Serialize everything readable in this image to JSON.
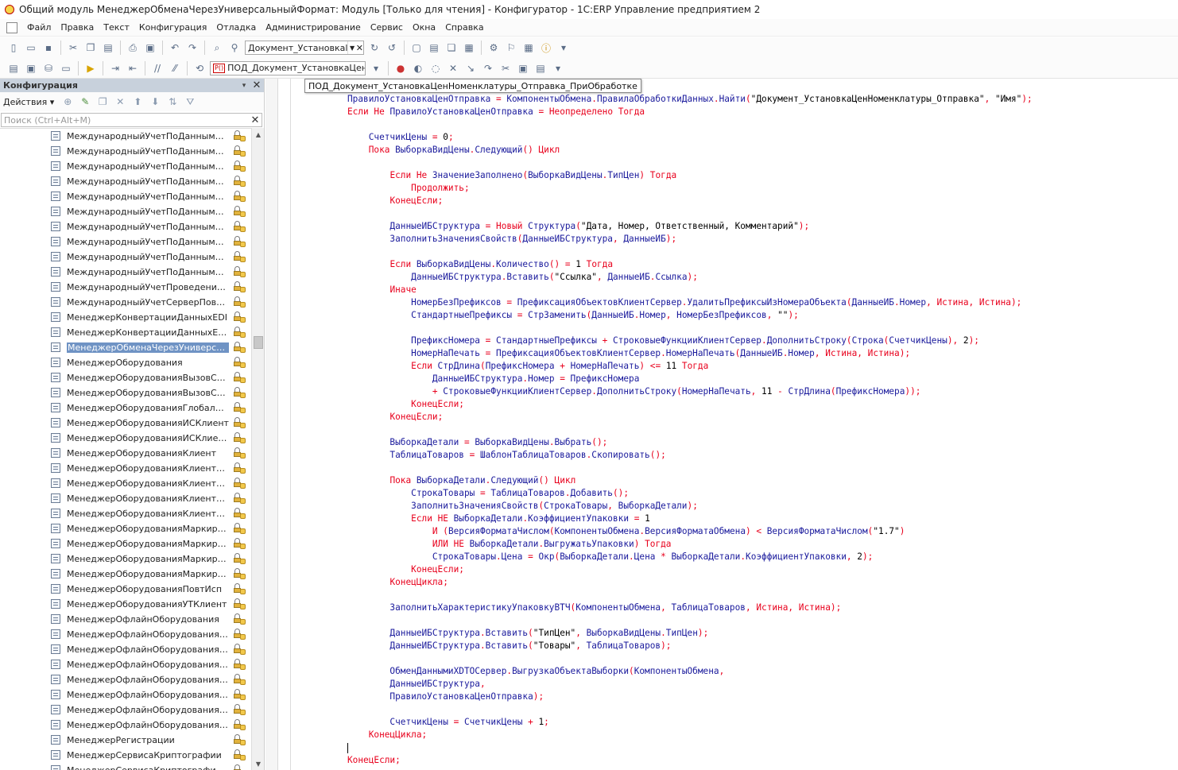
{
  "window": {
    "title": "Общий модуль МенеджерОбменаЧерезУниверсальныйФормат: Модуль [Только для чтения] - Конфигуратор - 1С:ERP Управление предприятием 2"
  },
  "menu": {
    "items": [
      "Файл",
      "Правка",
      "Текст",
      "Конфигурация",
      "Отладка",
      "Администрирование",
      "Сервис",
      "Окна",
      "Справка"
    ]
  },
  "toolbar1": {
    "search_combo_value": "Документ_Установкаl"
  },
  "toolbar2": {
    "procedure_combo_value": "ПОД_Документ_УстановкаЦен"
  },
  "panel": {
    "title": "Конфигурация",
    "actions_label": "Действия",
    "search_placeholder": "Поиск (Ctrl+Alt+M)",
    "items": [
      "МеждународныйУчетПоДаннымДоку...",
      "МеждународныйУчетПоДаннымОпера...",
      "МеждународныйУчетПоДаннымОпера...",
      "МеждународныйУчетПоДаннымРеглУ...",
      "МеждународныйУчетПоДаннымРеглУ...",
      "МеждународныйУчетПоДаннымФина...",
      "МеждународныйУчетПоДаннымФина...",
      "МеждународныйУчетПоДаннымФина...",
      "МеждународныйУчетПоДаннымФина...",
      "МеждународныйУчетПоДаннымФина...",
      "МеждународныйУчетПроведениеСерв...",
      "МеждународныйУчетСерверПовтИсп",
      "МенеджерКонвертацииДанныхEDI",
      "МенеджерКонвертацииДанныхEDIПов...",
      "МенеджерОбменаЧерезУниверсальн...",
      "МенеджерОборудования",
      "МенеджерОборудованияВызовСервера",
      "МенеджерОборудованияВызовСервер...",
      "МенеджерОборудованияГлобальный",
      "МенеджерОборудованияИСКлиент",
      "МенеджерОборудованияИСКлиентПов...",
      "МенеджерОборудованияКлиент",
      "МенеджерОборудованияКлиентПерео...",
      "МенеджерОборудованияКлиентПовтИ...",
      "МенеджерОборудованияКлиентСервер",
      "МенеджерОборудованияКлиентСерве...",
      "МенеджерОборудованияМаркировка",
      "МенеджерОборудованияМаркировкаВ...",
      "МенеджерОборудованияМаркировкаК...",
      "МенеджерОборудованияМаркировкаК...",
      "МенеджерОборудованияПовтИсп",
      "МенеджерОборудованияУТКлиент",
      "МенеджерОфлайнОборудования",
      "МенеджерОфлайнОборудованияWebC...",
      "МенеджерОфлайнОборудованияВызо...",
      "МенеджерОфлайнОборудованияВызо...",
      "МенеджерОфлайнОборудованияКлиент",
      "МенеджерОфлайнОборудованияКлиен...",
      "МенеджерОфлайнОборудованияКлиен...",
      "МенеджерОфлайнОборудованияПере...",
      "МенеджерРегистрации",
      "МенеджерСервисаКриптографии",
      "МенеджерСервисаКриптографииКлие..."
    ],
    "selected_index": 14
  },
  "editor": {
    "tooltip": "ПОД_Документ_УстановкаЦенНоменклатуры_Отправка_ПриОбработке",
    "lines": [
      "ПравилоУстановкаЦенОтправка = КомпонентыОбмена.ПравилаОбработкиДанных.Найти(\"Документ_УстановкаЦенНоменклатуры_Отправка\", \"Имя\");",
      "Если Не ПравилоУстановкаЦенОтправка = Неопределено Тогда",
      "",
      "    СчетчикЦены = 0;",
      "    Пока ВыборкаВидЦены.Следующий() Цикл",
      "",
      "        Если Не ЗначениеЗаполнено(ВыборкаВидЦены.ТипЦен) Тогда",
      "            Продолжить;",
      "        КонецЕсли;",
      "",
      "        ДанныеИБСтруктура = Новый Структура(\"Дата, Номер, Ответственный, Комментарий\");",
      "        ЗаполнитьЗначенияСвойств(ДанныеИБСтруктура, ДанныеИБ);",
      "",
      "        Если ВыборкаВидЦены.Количество() = 1 Тогда",
      "            ДанныеИБСтруктура.Вставить(\"Ссылка\", ДанныеИБ.Ссылка);",
      "        Иначе",
      "            НомерБезПрефиксов = ПрефиксацияОбъектовКлиентСервер.УдалитьПрефиксыИзНомераОбъекта(ДанныеИБ.Номер, Истина, Истина);",
      "            СтандартныеПрефиксы = СтрЗаменить(ДанныеИБ.Номер, НомерБезПрефиксов, \"\");",
      "",
      "            ПрефиксНомера = СтандартныеПрефиксы + СтроковыеФункцииКлиентСервер.ДополнитьСтроку(Строка(СчетчикЦены), 2);",
      "            НомерНаПечать = ПрефиксацияОбъектовКлиентСервер.НомерНаПечать(ДанныеИБ.Номер, Истина, Истина);",
      "            Если СтрДлина(ПрефиксНомера + НомерНаПечать) <= 11 Тогда",
      "                ДанныеИБСтруктура.Номер = ПрефиксНомера",
      "                + СтроковыеФункцииКлиентСервер.ДополнитьСтроку(НомерНаПечать, 11 - СтрДлина(ПрефиксНомера));",
      "            КонецЕсли;",
      "        КонецЕсли;",
      "",
      "        ВыборкаДетали = ВыборкаВидЦены.Выбрать();",
      "        ТаблицаТоваров = ШаблонТаблицаТоваров.Скопировать();",
      "",
      "        Пока ВыборкаДетали.Следующий() Цикл",
      "            СтрокаТовары = ТаблицаТоваров.Добавить();",
      "            ЗаполнитьЗначенияСвойств(СтрокаТовары, ВыборкаДетали);",
      "            Если НЕ ВыборкаДетали.КоэффициентУпаковки = 1",
      "                И (ВерсияФорматаЧислом(КомпонентыОбмена.ВерсияФорматаОбмена) < ВерсияФорматаЧислом(\"1.7\")",
      "                ИЛИ НЕ ВыборкаДетали.ВыгружатьУпаковки) Тогда",
      "                СтрокаТовары.Цена = Окр(ВыборкаДетали.Цена * ВыборкаДетали.КоэффициентУпаковки, 2);",
      "            КонецЕсли;",
      "        КонецЦикла;",
      "",
      "        ЗаполнитьХарактеристикуУпаковкуВТЧ(КомпонентыОбмена, ТаблицаТоваров, Истина, Истина);",
      "",
      "        ДанныеИБСтруктура.Вставить(\"ТипЦен\", ВыборкаВидЦены.ТипЦен);",
      "        ДанныеИБСтруктура.Вставить(\"Товары\", ТаблицаТоваров);",
      "",
      "        ОбменДаннымиXDTOСервер.ВыгрузкаОбъектаВыборки(КомпонентыОбмена,",
      "        ДанныеИБСтруктура,",
      "        ПравилоУстановкаЦенОтправка);",
      "",
      "        СчетчикЦены = СчетчикЦены + 1;",
      "    КонецЦикла;",
      "",
      "КонецЕсли;"
    ],
    "caret_line": 51
  },
  "colors": {
    "keyword": "#e8001c",
    "identifier": "#1a1a9c",
    "string": "#000000",
    "selection": "#6f93c4",
    "panel_header": "#c8d1dc"
  }
}
